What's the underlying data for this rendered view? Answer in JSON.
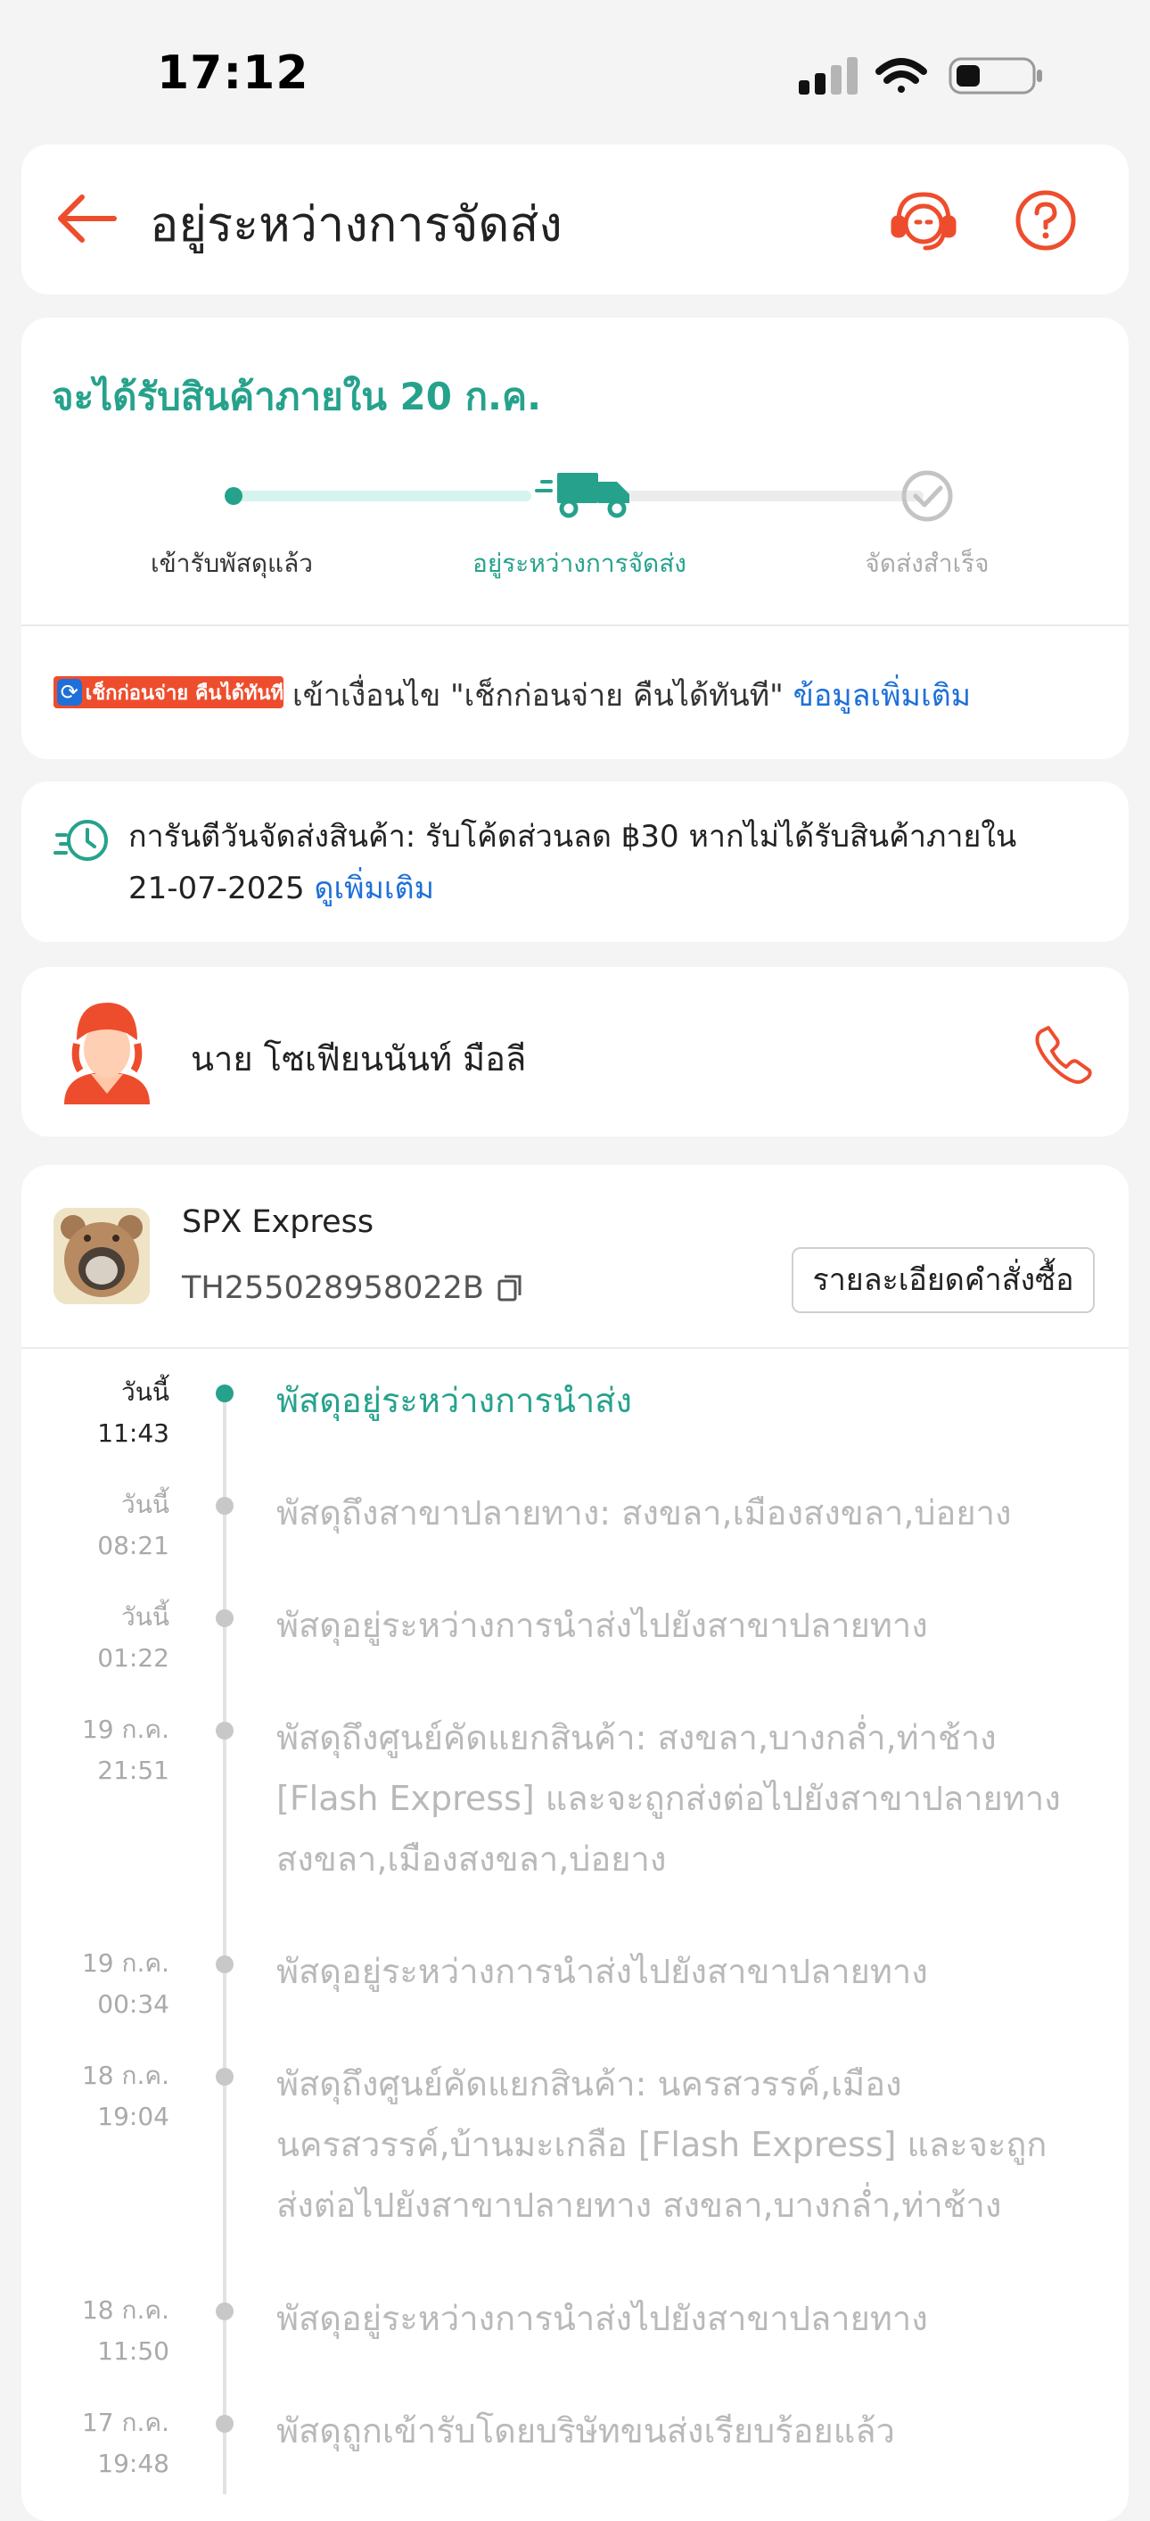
{
  "status_bar": {
    "time": "17:12"
  },
  "header": {
    "title": "อยู่ระหว่างการจัดส่ง"
  },
  "delivery": {
    "estimate": "จะได้รับสินค้าภายใน 20 ก.ค.",
    "steps": [
      {
        "label": "เข้ารับพัสดุแล้ว",
        "state": "done"
      },
      {
        "label": "อยู่ระหว่างการจัดส่ง",
        "state": "current"
      },
      {
        "label": "จัดส่งสำเร็จ",
        "state": "pending"
      }
    ],
    "colors": {
      "accent": "#26a28c",
      "track_done": "#d6f3ee",
      "track_pending": "#ececec"
    }
  },
  "check_policy": {
    "badge_text": "เช็กก่อนจ่าย คืนได้ทันที",
    "text": "เข้าเงื่อนไข \"เช็กก่อนจ่าย คืนได้ทันที\"",
    "link": "ข้อมูลเพิ่มเติม"
  },
  "guarantee": {
    "line1": "การันตีวันจัดส่งสินค้า: รับโค้ดส่วนลด ฿30 หากไม่ได้รับสินค้าภายใน",
    "line2": "21-07-2025",
    "link": "ดูเพิ่มเติม"
  },
  "courier": {
    "name": "นาย โซเฟียนนันท์ มือลี"
  },
  "shipment": {
    "carrier": "SPX Express",
    "tracking": "TH255028958022B",
    "order_button": "รายละเอียดคำสั่งซื้อ"
  },
  "timeline": [
    {
      "day": "วันนี้",
      "time": "11:43",
      "lines": [
        "พัสดุอยู่ระหว่างการนำส่ง"
      ],
      "active": true
    },
    {
      "day": "วันนี้",
      "time": "08:21",
      "lines": [
        "พัสดุถึงสาขาปลายทาง: สงขลา,เมืองสงขลา,บ่อยาง"
      ],
      "active": false
    },
    {
      "day": "วันนี้",
      "time": "01:22",
      "lines": [
        "พัสดุอยู่ระหว่างการนำส่งไปยังสาขาปลายทาง"
      ],
      "active": false
    },
    {
      "day": "19 ก.ค.",
      "time": "21:51",
      "lines": [
        "พัสดุถึงศูนย์คัดแยกสินค้า: สงขลา,บางกล่ำ,ท่าช้าง",
        "[Flash Express] และจะถูกส่งต่อไปยังสาขาปลายทาง",
        "สงขลา,เมืองสงขลา,บ่อยาง"
      ],
      "active": false
    },
    {
      "day": "19 ก.ค.",
      "time": "00:34",
      "lines": [
        "พัสดุอยู่ระหว่างการนำส่งไปยังสาขาปลายทาง"
      ],
      "active": false
    },
    {
      "day": "18 ก.ค.",
      "time": "19:04",
      "lines": [
        "พัสดุถึงศูนย์คัดแยกสินค้า: นครสวรรค์,เมือง",
        "นครสวรรค์,บ้านมะเกลือ  [Flash Express] และจะถูก",
        "ส่งต่อไปยังสาขาปลายทาง สงขลา,บางกล่ำ,ท่าช้าง"
      ],
      "active": false
    },
    {
      "day": "18 ก.ค.",
      "time": "11:50",
      "lines": [
        "พัสดุอยู่ระหว่างการนำส่งไปยังสาขาปลายทาง"
      ],
      "active": false
    },
    {
      "day": "17 ก.ค.",
      "time": "19:48",
      "lines": [
        "พัสดุถูกเข้ารับโดยบริษัทขนส่งเรียบร้อยแล้ว"
      ],
      "active": false
    }
  ]
}
